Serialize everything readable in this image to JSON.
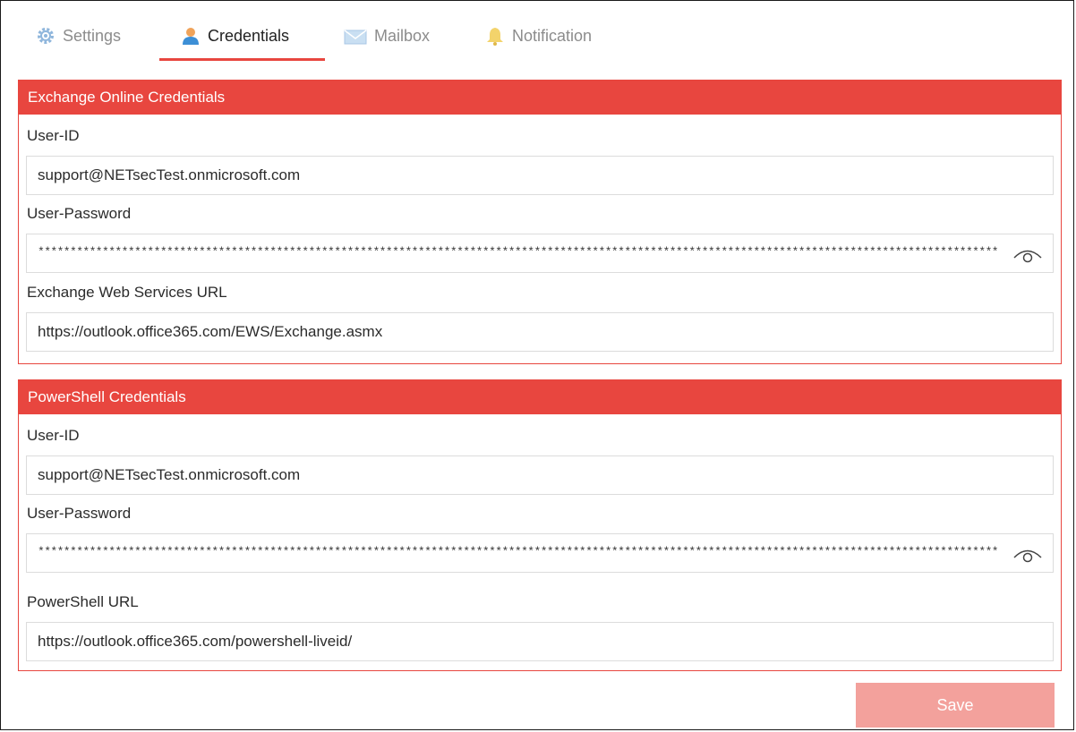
{
  "tabs": [
    {
      "label": "Settings",
      "icon": "gear-icon",
      "active": false
    },
    {
      "label": "Credentials",
      "icon": "user-icon",
      "active": true
    },
    {
      "label": "Mailbox",
      "icon": "mailbox-icon",
      "active": false
    },
    {
      "label": "Notification",
      "icon": "bell-icon",
      "active": false
    }
  ],
  "exchange": {
    "title": "Exchange Online Credentials",
    "user_id_label": "User-ID",
    "user_id_value": "support@NETsecTest.onmicrosoft.com",
    "password_label": "User-Password",
    "password_value": "**************************************************************************************************************************************************************************************************************************************",
    "url_label": "Exchange Web Services URL",
    "url_value": "https://outlook.office365.com/EWS/Exchange.asmx"
  },
  "powershell": {
    "title": "PowerShell Credentials",
    "user_id_label": "User-ID",
    "user_id_value": "support@NETsecTest.onmicrosoft.com",
    "password_label": "User-Password",
    "password_value": "**************************************************************************************************************************************************************************************************************************************",
    "url_label": "PowerShell URL",
    "url_value": "https://outlook.office365.com/powershell-liveid/"
  },
  "save_label": "Save",
  "colors": {
    "accent": "#e8463f",
    "save_disabled": "#f3a19c"
  }
}
